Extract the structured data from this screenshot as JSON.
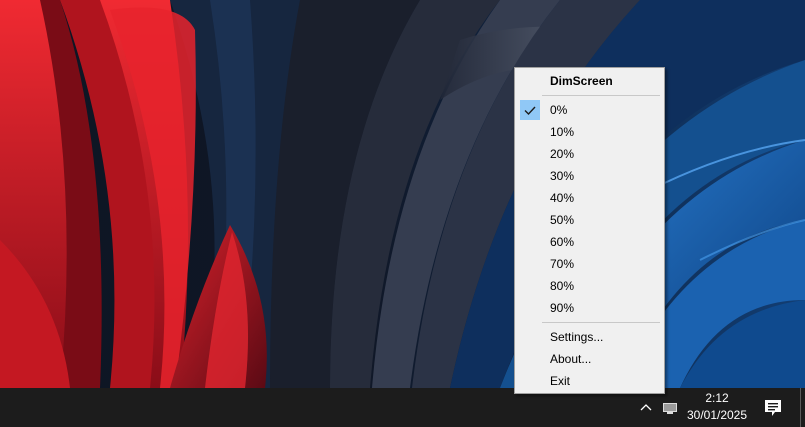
{
  "menu": {
    "title": "DimScreen",
    "dim_levels": [
      {
        "label": "0%",
        "checked": true
      },
      {
        "label": "10%",
        "checked": false
      },
      {
        "label": "20%",
        "checked": false
      },
      {
        "label": "30%",
        "checked": false
      },
      {
        "label": "40%",
        "checked": false
      },
      {
        "label": "50%",
        "checked": false
      },
      {
        "label": "60%",
        "checked": false
      },
      {
        "label": "70%",
        "checked": false
      },
      {
        "label": "80%",
        "checked": false
      },
      {
        "label": "90%",
        "checked": false
      }
    ],
    "actions": [
      {
        "label": "Settings..."
      },
      {
        "label": "About..."
      },
      {
        "label": "Exit"
      }
    ]
  },
  "taskbar": {
    "time": "2:12",
    "date": "30/01/2025",
    "icons": [
      "chevron-up-icon",
      "display-icon",
      "notification-icon"
    ]
  },
  "colors": {
    "taskbar": "#1c1c1c",
    "menu_background": "#f0f0f0",
    "check_highlight": "#90c8f6"
  }
}
